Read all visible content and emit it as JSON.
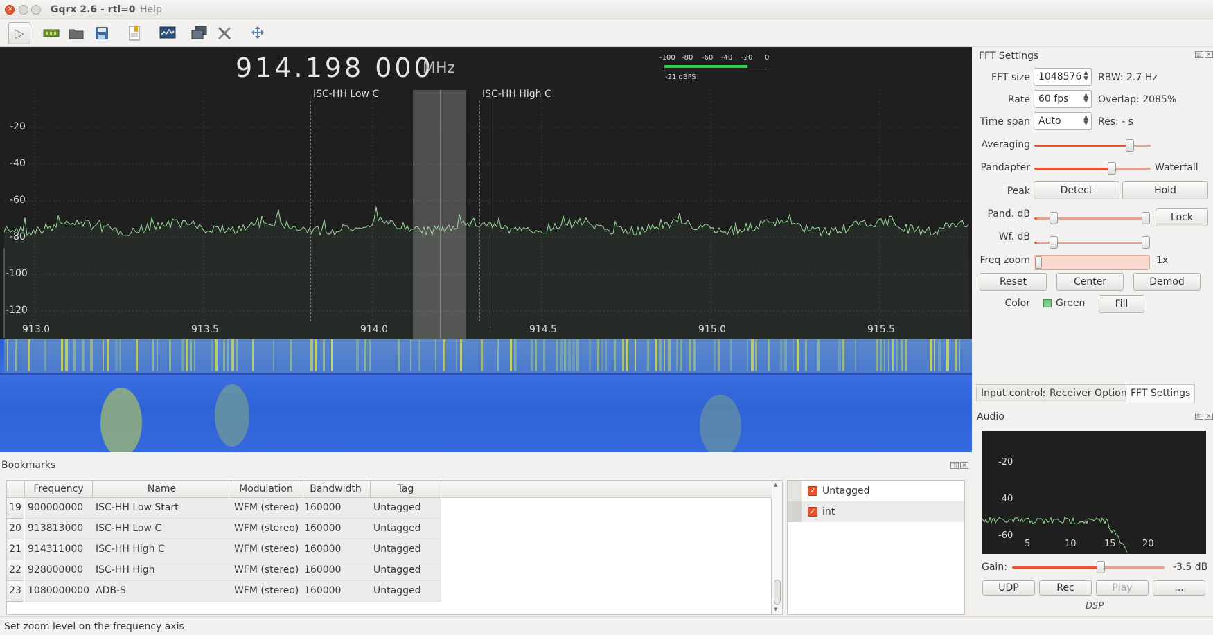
{
  "window": {
    "title": "Gqrx 2.6 - rtl=0",
    "menu_visible": "Help"
  },
  "colors": {
    "accent": "#e9542e",
    "spectrum_line": "#9de09d",
    "plot_bg": "#1f1f1f",
    "passband_marker": "#e05555"
  },
  "toolbar": {
    "icons": [
      "play-icon",
      "hardware-icon",
      "open-icon",
      "save-icon",
      "bookmark-icon",
      "screenshot-icon",
      "remote-control-icon",
      "settings-icon",
      "fullscreen-icon"
    ]
  },
  "spectrum": {
    "frequency": "914.198 000",
    "unit": "MHz",
    "dbfs_ticks": [
      "-100",
      "-80",
      "-60",
      "-40",
      "-20",
      "0"
    ],
    "dbfs_value": "-21 dBFS",
    "y_ticks": [
      "-20",
      "-40",
      "-60",
      "-80",
      "-100",
      "-120"
    ],
    "x_ticks": [
      "913.0",
      "913.5",
      "914.0",
      "914.5",
      "915.0",
      "915.5"
    ],
    "bookmark_labels": [
      "ISC-HH Low C",
      "ISC-HH High C"
    ]
  },
  "fft": {
    "title": "FFT Settings",
    "fft_size_label": "FFT size",
    "fft_size": "1048576",
    "rbw": "RBW: 2.7 Hz",
    "rate_label": "Rate",
    "rate": "60 fps",
    "overlap": "Overlap: 2085%",
    "timespan_label": "Time span",
    "timespan": "Auto",
    "res": "Res: - s",
    "averaging_label": "Averaging",
    "pandapter_label": "Pandapter",
    "waterfall_label": "Waterfall",
    "peak_label": "Peak",
    "detect": "Detect",
    "hold": "Hold",
    "pand_db_label": "Pand. dB",
    "lock": "Lock",
    "wf_db_label": "Wf. dB",
    "freq_zoom_label": "Freq zoom",
    "freq_zoom_value": "1x",
    "reset": "Reset",
    "center": "Center",
    "demod": "Demod",
    "color_label": "Color",
    "color_value": "Green",
    "fill": "Fill"
  },
  "tabs": [
    "Input controls",
    "Receiver Options",
    "FFT Settings"
  ],
  "audio": {
    "title": "Audio",
    "y_ticks": [
      "-20",
      "-40",
      "-60"
    ],
    "x_ticks": [
      "5",
      "10",
      "15",
      "20"
    ],
    "gain_label": "Gain:",
    "gain_value": "-3.5 dB",
    "udp": "UDP",
    "rec": "Rec",
    "play": "Play",
    "more": "...",
    "dsp": "DSP"
  },
  "bookmarks": {
    "title": "Bookmarks",
    "columns": [
      "Frequency",
      "Name",
      "Modulation",
      "Bandwidth",
      "Tag"
    ],
    "rows": [
      {
        "num": "19",
        "frequency": "900000000",
        "name": "ISC-HH Low Start",
        "modulation": "WFM (stereo)",
        "bandwidth": "160000",
        "tag": "Untagged"
      },
      {
        "num": "20",
        "frequency": "913813000",
        "name": "ISC-HH Low C",
        "modulation": "WFM (stereo)",
        "bandwidth": "160000",
        "tag": "Untagged"
      },
      {
        "num": "21",
        "frequency": "914311000",
        "name": "ISC-HH High C",
        "modulation": "WFM (stereo)",
        "bandwidth": "160000",
        "tag": "Untagged"
      },
      {
        "num": "22",
        "frequency": "928000000",
        "name": "ISC-HH High",
        "modulation": "WFM (stereo)",
        "bandwidth": "160000",
        "tag": "Untagged"
      },
      {
        "num": "23",
        "frequency": "1080000000",
        "name": "ADB-S",
        "modulation": "WFM (stereo)",
        "bandwidth": "160000",
        "tag": "Untagged"
      }
    ],
    "tags": [
      "Untagged",
      "int"
    ]
  },
  "status": {
    "text": "Set zoom level on the frequency axis"
  }
}
